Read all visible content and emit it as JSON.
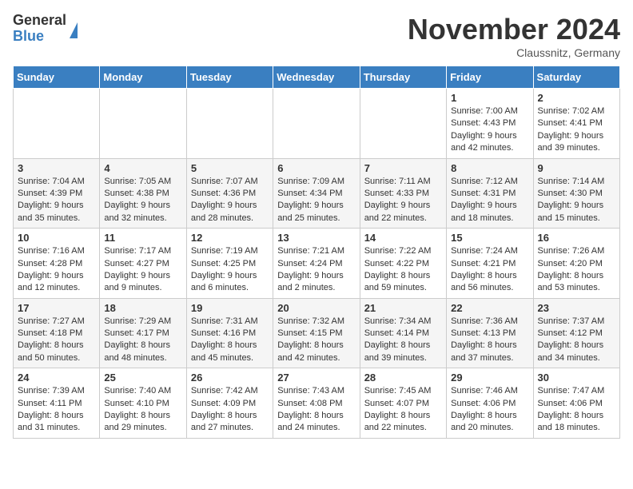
{
  "header": {
    "logo_general": "General",
    "logo_blue": "Blue",
    "month_title": "November 2024",
    "location": "Claussnitz, Germany"
  },
  "weekdays": [
    "Sunday",
    "Monday",
    "Tuesday",
    "Wednesday",
    "Thursday",
    "Friday",
    "Saturday"
  ],
  "weeks": [
    [
      {
        "day": "",
        "info": ""
      },
      {
        "day": "",
        "info": ""
      },
      {
        "day": "",
        "info": ""
      },
      {
        "day": "",
        "info": ""
      },
      {
        "day": "",
        "info": ""
      },
      {
        "day": "1",
        "info": "Sunrise: 7:00 AM\nSunset: 4:43 PM\nDaylight: 9 hours\nand 42 minutes."
      },
      {
        "day": "2",
        "info": "Sunrise: 7:02 AM\nSunset: 4:41 PM\nDaylight: 9 hours\nand 39 minutes."
      }
    ],
    [
      {
        "day": "3",
        "info": "Sunrise: 7:04 AM\nSunset: 4:39 PM\nDaylight: 9 hours\nand 35 minutes."
      },
      {
        "day": "4",
        "info": "Sunrise: 7:05 AM\nSunset: 4:38 PM\nDaylight: 9 hours\nand 32 minutes."
      },
      {
        "day": "5",
        "info": "Sunrise: 7:07 AM\nSunset: 4:36 PM\nDaylight: 9 hours\nand 28 minutes."
      },
      {
        "day": "6",
        "info": "Sunrise: 7:09 AM\nSunset: 4:34 PM\nDaylight: 9 hours\nand 25 minutes."
      },
      {
        "day": "7",
        "info": "Sunrise: 7:11 AM\nSunset: 4:33 PM\nDaylight: 9 hours\nand 22 minutes."
      },
      {
        "day": "8",
        "info": "Sunrise: 7:12 AM\nSunset: 4:31 PM\nDaylight: 9 hours\nand 18 minutes."
      },
      {
        "day": "9",
        "info": "Sunrise: 7:14 AM\nSunset: 4:30 PM\nDaylight: 9 hours\nand 15 minutes."
      }
    ],
    [
      {
        "day": "10",
        "info": "Sunrise: 7:16 AM\nSunset: 4:28 PM\nDaylight: 9 hours\nand 12 minutes."
      },
      {
        "day": "11",
        "info": "Sunrise: 7:17 AM\nSunset: 4:27 PM\nDaylight: 9 hours\nand 9 minutes."
      },
      {
        "day": "12",
        "info": "Sunrise: 7:19 AM\nSunset: 4:25 PM\nDaylight: 9 hours\nand 6 minutes."
      },
      {
        "day": "13",
        "info": "Sunrise: 7:21 AM\nSunset: 4:24 PM\nDaylight: 9 hours\nand 2 minutes."
      },
      {
        "day": "14",
        "info": "Sunrise: 7:22 AM\nSunset: 4:22 PM\nDaylight: 8 hours\nand 59 minutes."
      },
      {
        "day": "15",
        "info": "Sunrise: 7:24 AM\nSunset: 4:21 PM\nDaylight: 8 hours\nand 56 minutes."
      },
      {
        "day": "16",
        "info": "Sunrise: 7:26 AM\nSunset: 4:20 PM\nDaylight: 8 hours\nand 53 minutes."
      }
    ],
    [
      {
        "day": "17",
        "info": "Sunrise: 7:27 AM\nSunset: 4:18 PM\nDaylight: 8 hours\nand 50 minutes."
      },
      {
        "day": "18",
        "info": "Sunrise: 7:29 AM\nSunset: 4:17 PM\nDaylight: 8 hours\nand 48 minutes."
      },
      {
        "day": "19",
        "info": "Sunrise: 7:31 AM\nSunset: 4:16 PM\nDaylight: 8 hours\nand 45 minutes."
      },
      {
        "day": "20",
        "info": "Sunrise: 7:32 AM\nSunset: 4:15 PM\nDaylight: 8 hours\nand 42 minutes."
      },
      {
        "day": "21",
        "info": "Sunrise: 7:34 AM\nSunset: 4:14 PM\nDaylight: 8 hours\nand 39 minutes."
      },
      {
        "day": "22",
        "info": "Sunrise: 7:36 AM\nSunset: 4:13 PM\nDaylight: 8 hours\nand 37 minutes."
      },
      {
        "day": "23",
        "info": "Sunrise: 7:37 AM\nSunset: 4:12 PM\nDaylight: 8 hours\nand 34 minutes."
      }
    ],
    [
      {
        "day": "24",
        "info": "Sunrise: 7:39 AM\nSunset: 4:11 PM\nDaylight: 8 hours\nand 31 minutes."
      },
      {
        "day": "25",
        "info": "Sunrise: 7:40 AM\nSunset: 4:10 PM\nDaylight: 8 hours\nand 29 minutes."
      },
      {
        "day": "26",
        "info": "Sunrise: 7:42 AM\nSunset: 4:09 PM\nDaylight: 8 hours\nand 27 minutes."
      },
      {
        "day": "27",
        "info": "Sunrise: 7:43 AM\nSunset: 4:08 PM\nDaylight: 8 hours\nand 24 minutes."
      },
      {
        "day": "28",
        "info": "Sunrise: 7:45 AM\nSunset: 4:07 PM\nDaylight: 8 hours\nand 22 minutes."
      },
      {
        "day": "29",
        "info": "Sunrise: 7:46 AM\nSunset: 4:06 PM\nDaylight: 8 hours\nand 20 minutes."
      },
      {
        "day": "30",
        "info": "Sunrise: 7:47 AM\nSunset: 4:06 PM\nDaylight: 8 hours\nand 18 minutes."
      }
    ]
  ]
}
